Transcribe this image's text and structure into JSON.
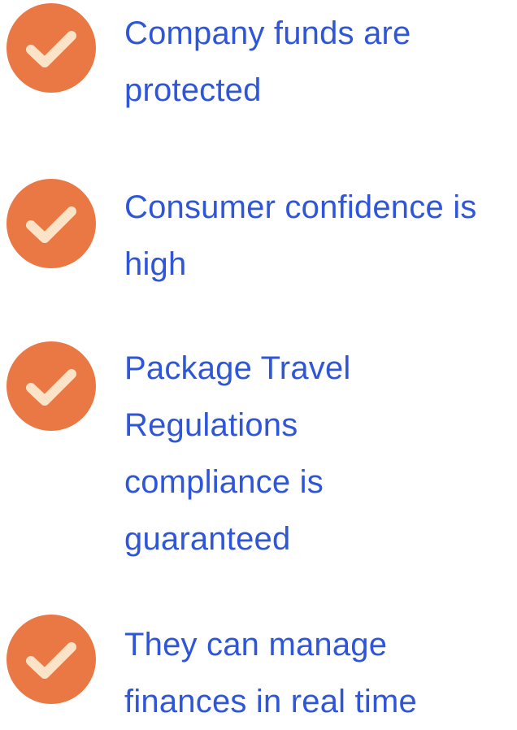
{
  "accent": {
    "check_circle": "#E97844",
    "check_mark": "#FBE3C7",
    "text": "#2F56D9"
  },
  "benefits": [
    {
      "icon": "checkmark-circle-icon",
      "text": "Company funds are protected"
    },
    {
      "icon": "checkmark-circle-icon",
      "text": "Consumer confidence is high"
    },
    {
      "icon": "checkmark-circle-icon",
      "text": "Package Travel Regulations compliance is guaranteed"
    },
    {
      "icon": "checkmark-circle-icon",
      "text": "They can manage finances in real time"
    }
  ]
}
